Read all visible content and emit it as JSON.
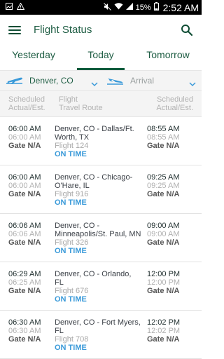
{
  "statusbar": {
    "battery": "15%",
    "time": "2:52 AM"
  },
  "appbar": {
    "title": "Flight Status"
  },
  "tabs": [
    {
      "label": "Yesterday"
    },
    {
      "label": "Today"
    },
    {
      "label": "Tomorrow"
    }
  ],
  "filters": {
    "city": "Denver, CO",
    "mode": "Arrival"
  },
  "header": {
    "col1_line1": "Scheduled",
    "col1_line2": "Actual/Est.",
    "col2_line1": "Flight",
    "col2_line2": "Travel Route",
    "col3_line1": "Scheduled",
    "col3_line2": "Actual/Est."
  },
  "flights": [
    {
      "dep_sched": "06:00 AM",
      "dep_actual": "06:00 AM",
      "dep_gate": "Gate N/A",
      "route_l1": "Denver, CO - Dallas/Ft.",
      "route_l2": "Worth, TX",
      "flight": "Flight  124",
      "status": "ON TIME",
      "arr_sched": "08:55 AM",
      "arr_actual": "08:55 AM",
      "arr_gate": "Gate N/A"
    },
    {
      "dep_sched": "06:00 AM",
      "dep_actual": "06:00 AM",
      "dep_gate": "Gate N/A",
      "route_l1": "Denver, CO - Chicago-",
      "route_l2": "O'Hare, IL",
      "flight": "Flight  916",
      "status": "ON TIME",
      "arr_sched": "09:25 AM",
      "arr_actual": "09:25 AM",
      "arr_gate": "Gate N/A"
    },
    {
      "dep_sched": "06:06 AM",
      "dep_actual": "06:06 AM",
      "dep_gate": "Gate N/A",
      "route_l1": "Denver, CO -",
      "route_l2": "Minneapolis/St. Paul, MN",
      "flight": "Flight  326",
      "status": "ON TIME",
      "arr_sched": "09:00 AM",
      "arr_actual": "09:00 AM",
      "arr_gate": "Gate N/A"
    },
    {
      "dep_sched": "06:29 AM",
      "dep_actual": "06:25 AM",
      "dep_gate": "Gate N/A",
      "route_l1": "Denver, CO - Orlando,",
      "route_l2": "FL",
      "flight": "Flight  676",
      "status": "ON TIME",
      "arr_sched": "12:00 PM",
      "arr_actual": "12:00 PM",
      "arr_gate": "Gate N/A"
    },
    {
      "dep_sched": "06:30 AM",
      "dep_actual": "06:30 AM",
      "dep_gate": "Gate N/A",
      "route_l1": "Denver, CO - Fort Myers,",
      "route_l2": "FL",
      "flight": "Flight  708",
      "status": "ON TIME",
      "arr_sched": "12:02 PM",
      "arr_actual": "12:02 PM",
      "arr_gate": "Gate N/A"
    }
  ],
  "icons": {
    "menu": "menu-icon",
    "search": "search-icon",
    "departure": "airplane-departure-icon",
    "arrival": "airplane-arrival-icon"
  },
  "colors": {
    "brand": "#1f5e44",
    "status_on_time": "#3a9ad9"
  }
}
